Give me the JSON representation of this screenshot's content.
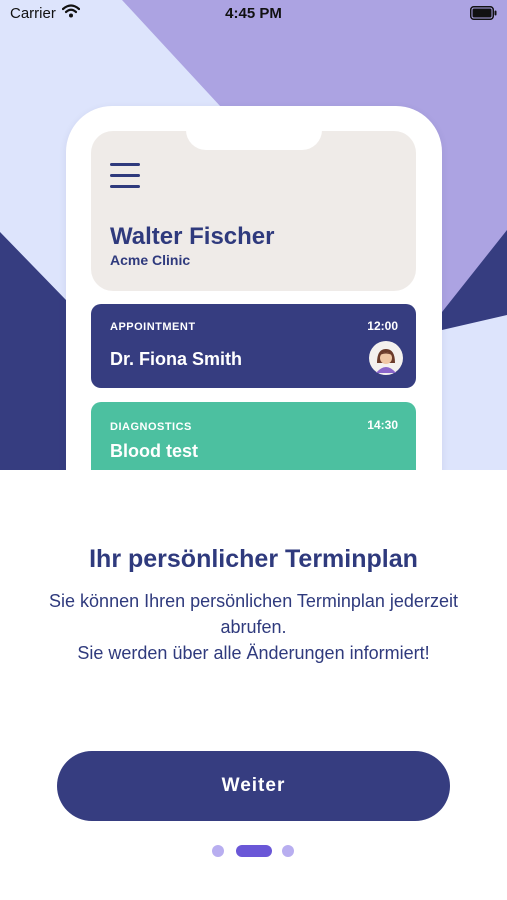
{
  "status_bar": {
    "carrier": "Carrier",
    "time": "4:45 PM"
  },
  "illustration": {
    "profile": {
      "name": "Walter Fischer",
      "clinic": "Acme Clinic"
    },
    "appointment_card": {
      "label": "APPOINTMENT",
      "time": "12:00",
      "title": "Dr. Fiona Smith"
    },
    "diagnostics_card": {
      "label": "DIAGNOSTICS",
      "time": "14:30",
      "title": "Blood test"
    }
  },
  "onboarding": {
    "heading": "Ihr persönlicher Terminplan",
    "line1": "Sie können Ihren persönlichen Terminplan jederzeit abrufen.",
    "line2": "Sie werden über alle Änderungen informiert!",
    "button_label": "Weiter",
    "page_count": 3,
    "current_page": 2
  },
  "colors": {
    "navy": "#363d80",
    "teal": "#4cc0a0",
    "lavender": "#aca3e2",
    "light_blue": "#dde4fc",
    "accent": "#6a57d7"
  }
}
